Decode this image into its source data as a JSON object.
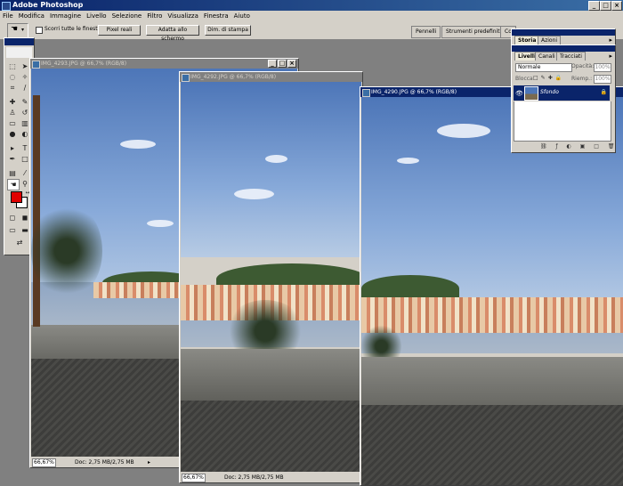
{
  "app": {
    "title": "Adobe Photoshop"
  },
  "menu": {
    "items": [
      "File",
      "Modifica",
      "Immagine",
      "Livello",
      "Selezione",
      "Filtro",
      "Visualizza",
      "Finestra",
      "Aiuto"
    ]
  },
  "options": {
    "scroll_all_label": "Scorri tutte le finestre",
    "buttons": [
      "Pixel reali",
      "Adatta allo schermo",
      "Dim. di stampa"
    ],
    "wells": [
      "Pennelli",
      "Strumenti predefiniti",
      "Co"
    ]
  },
  "docs": [
    {
      "title": "IMG_4293.JPG @ 66,7% (RGB/8)",
      "zoom": "66,67%",
      "info": "Doc: 2,75 MB/2,75 MB",
      "active": false
    },
    {
      "title": "IMG_4292.JPG @ 66,7% (RGB/8)",
      "zoom": "66,67%",
      "info": "Doc: 2,75 MB/2,75 MB",
      "active": false
    },
    {
      "title": "IMG_4290.JPG @ 66,7% (RGB/8)",
      "zoom": "",
      "info": "",
      "active": true
    }
  ],
  "history_panel": {
    "tabs": [
      "Storia",
      "Azioni"
    ]
  },
  "layers_panel": {
    "tabs": [
      "Livelli",
      "Canali",
      "Tracciati"
    ],
    "blend_mode": "Normale",
    "opacity_label": "Opacità:",
    "opacity_value": "100%",
    "lock_label": "Blocca:",
    "fill_label": "Riemp.:",
    "fill_value": "100%",
    "layers": [
      {
        "name": "Sfondo"
      }
    ]
  },
  "colors": {
    "foreground": "#e00000",
    "background": "#ffffff",
    "active_title": "#0a246a"
  }
}
